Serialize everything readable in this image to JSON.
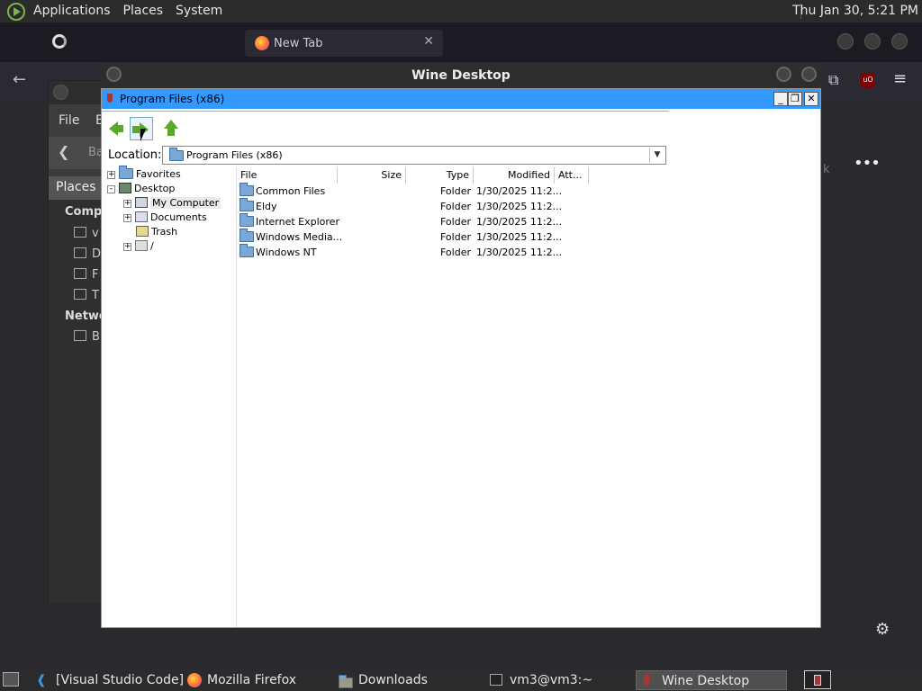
{
  "top_panel": {
    "menus": [
      "Applications",
      "Places",
      "System"
    ],
    "clock": "Thu Jan 30,  5:21 PM"
  },
  "firefox": {
    "tab_inactive_title": "",
    "tab_active_title": "New Tab"
  },
  "caja": {
    "menu_file": "File",
    "menu_edit": "E",
    "places_label": "Places",
    "back_label": "Ba",
    "section_computer": "Compu",
    "section_network": "Netwo",
    "items": [
      "v",
      "D",
      "F",
      "T"
    ],
    "network_items": [
      "B"
    ]
  },
  "wine_desktop": {
    "title": "Wine Desktop"
  },
  "explorer": {
    "title": "Program Files (x86)",
    "location_label": "Location:",
    "location_value": "Program Files (x86)",
    "tree": [
      {
        "label": "Favorites",
        "expander": "+",
        "icon": "folder-icon"
      },
      {
        "label": "Desktop",
        "expander": "-",
        "icon": "desktop-icon"
      },
      {
        "label": "My Computer",
        "expander": "+",
        "icon": "computer-icon"
      },
      {
        "label": "Documents",
        "expander": "+",
        "icon": "documents-icon"
      },
      {
        "label": "Trash",
        "expander": "",
        "icon": "trash-icon"
      },
      {
        "label": "/",
        "expander": "+",
        "icon": "drive-icon"
      }
    ],
    "columns": [
      "File",
      "Size",
      "Type",
      "Modified",
      "Att..."
    ],
    "rows": [
      {
        "name": "Common Files",
        "size": "",
        "type": "Folder",
        "modified": "1/30/2025 11:2..."
      },
      {
        "name": "Eldy",
        "size": "",
        "type": "Folder",
        "modified": "1/30/2025 11:2..."
      },
      {
        "name": "Internet Explorer",
        "size": "",
        "type": "Folder",
        "modified": "1/30/2025 11:2..."
      },
      {
        "name": "Windows Media...",
        "size": "",
        "type": "Folder",
        "modified": "1/30/2025 11:2..."
      },
      {
        "name": "Windows NT",
        "size": "",
        "type": "Folder",
        "modified": "1/30/2025 11:2..."
      }
    ]
  },
  "taskbar": {
    "tasks": [
      {
        "label": "[Visual Studio Code]",
        "icon": "vscode-icon"
      },
      {
        "label": "Mozilla Firefox",
        "icon": "firefox-icon"
      },
      {
        "label": "Downloads",
        "icon": "folder-icon"
      },
      {
        "label": "vm3@vm3:~",
        "icon": "terminal-icon"
      },
      {
        "label": "Wine Desktop",
        "icon": "wine-icon"
      }
    ]
  }
}
